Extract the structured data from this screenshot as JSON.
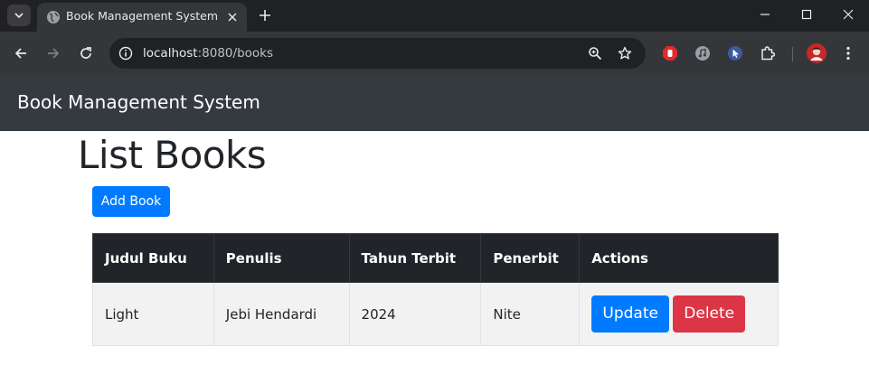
{
  "browser": {
    "tab_title": "Book Management System",
    "url_host": "localhost",
    "url_path": ":8080/books"
  },
  "navbar": {
    "brand": "Book Management System"
  },
  "main": {
    "title": "List Books",
    "add_button": "Add Book",
    "table": {
      "headers": [
        "Judul Buku",
        "Penulis",
        "Tahun Terbit",
        "Penerbit",
        "Actions"
      ],
      "rows": [
        {
          "judul": "Light",
          "penulis": "Jebi Hendardi",
          "tahun": "2024",
          "penerbit": "Nite",
          "update_label": "Update",
          "delete_label": "Delete"
        }
      ]
    }
  },
  "colors": {
    "navbar_bg": "#343a40",
    "primary": "#007bff",
    "danger": "#dc3545",
    "table_header_bg": "#212529"
  }
}
